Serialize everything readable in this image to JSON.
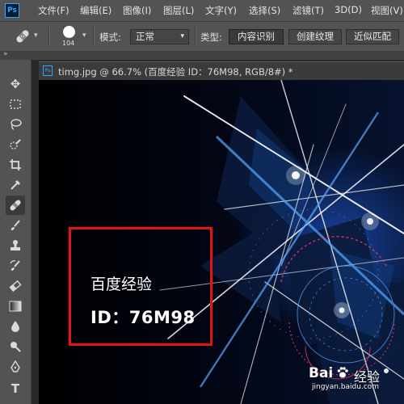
{
  "app": {
    "logo": "Ps"
  },
  "menu": {
    "items": [
      "文件(F)",
      "编辑(E)",
      "图像(I)",
      "图层(L)",
      "文字(Y)",
      "选择(S)",
      "滤镜(T)",
      "3D(D)",
      "视图(V)"
    ]
  },
  "options": {
    "brush_size": "104",
    "mode_label": "模式:",
    "mode_value": "正常",
    "type_label": "类型:",
    "type_buttons": [
      "内容识别",
      "创建纹理",
      "近似匹配"
    ]
  },
  "panel_strip": {
    "collapse_glyph": "»"
  },
  "toolbar": {
    "tools": [
      {
        "icon": "move-tool-icon",
        "glyph": "✥"
      },
      {
        "icon": "marquee-tool-icon",
        "glyph": ""
      },
      {
        "icon": "lasso-tool-icon",
        "glyph": ""
      },
      {
        "icon": "quick-select-tool-icon",
        "glyph": ""
      },
      {
        "icon": "crop-tool-icon",
        "glyph": ""
      },
      {
        "icon": "eyedropper-tool-icon",
        "glyph": ""
      },
      {
        "icon": "spot-healing-brush-icon",
        "glyph": ""
      },
      {
        "icon": "brush-tool-icon",
        "glyph": ""
      },
      {
        "icon": "clone-stamp-tool-icon",
        "glyph": ""
      },
      {
        "icon": "history-brush-icon",
        "glyph": ""
      },
      {
        "icon": "eraser-tool-icon",
        "glyph": ""
      },
      {
        "icon": "gradient-tool-icon",
        "glyph": ""
      },
      {
        "icon": "blur-tool-icon",
        "glyph": "●"
      },
      {
        "icon": "dodge-tool-icon",
        "glyph": ""
      },
      {
        "icon": "pen-tool-icon",
        "glyph": ""
      },
      {
        "icon": "type-tool-icon",
        "glyph": "T"
      }
    ],
    "active_tool": "spot-healing-brush-icon"
  },
  "document": {
    "tab_title": "timg.jpg @ 66.7% (百度经验 ID：76M98, RGB/8#) *",
    "tab_icon": "Ps"
  },
  "canvas_text": {
    "line1": "百度经验",
    "line2": "ID：76M98"
  },
  "watermark": {
    "brand": "Bai",
    "brand_suffix": "经验",
    "url": "jingyan.baidu.com"
  },
  "colors": {
    "ui_bg": "#535353",
    "accent": "#31a8ff",
    "highlight_box": "#e5140f"
  }
}
